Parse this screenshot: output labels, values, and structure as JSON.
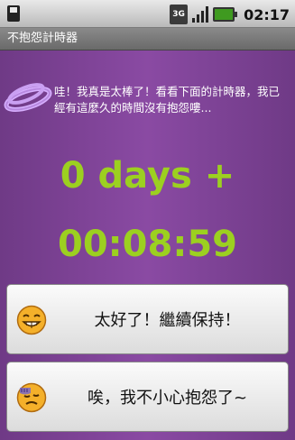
{
  "status_bar": {
    "network_label": "3G",
    "time": "02:17",
    "icons": [
      "sd-card-icon",
      "network-3g-icon",
      "signal-icon",
      "battery-icon"
    ]
  },
  "title_bar": {
    "title": "不抱怨計時器"
  },
  "main": {
    "message": "哇！我真是太棒了！看看下面的計時器，我已經有這麼久的時間沒有抱怨嘍...",
    "days_label": "0 days +",
    "timer": "00:08:59"
  },
  "buttons": [
    {
      "label": "太好了！繼續保持！",
      "icon": "grinning-face-icon"
    },
    {
      "label": "唉，我不小心抱怨了~",
      "icon": "sweating-face-icon"
    }
  ],
  "colors": {
    "timer_green": "#9cd020",
    "background_purple": "#7b4394",
    "title_bar_gray": "#777777"
  }
}
